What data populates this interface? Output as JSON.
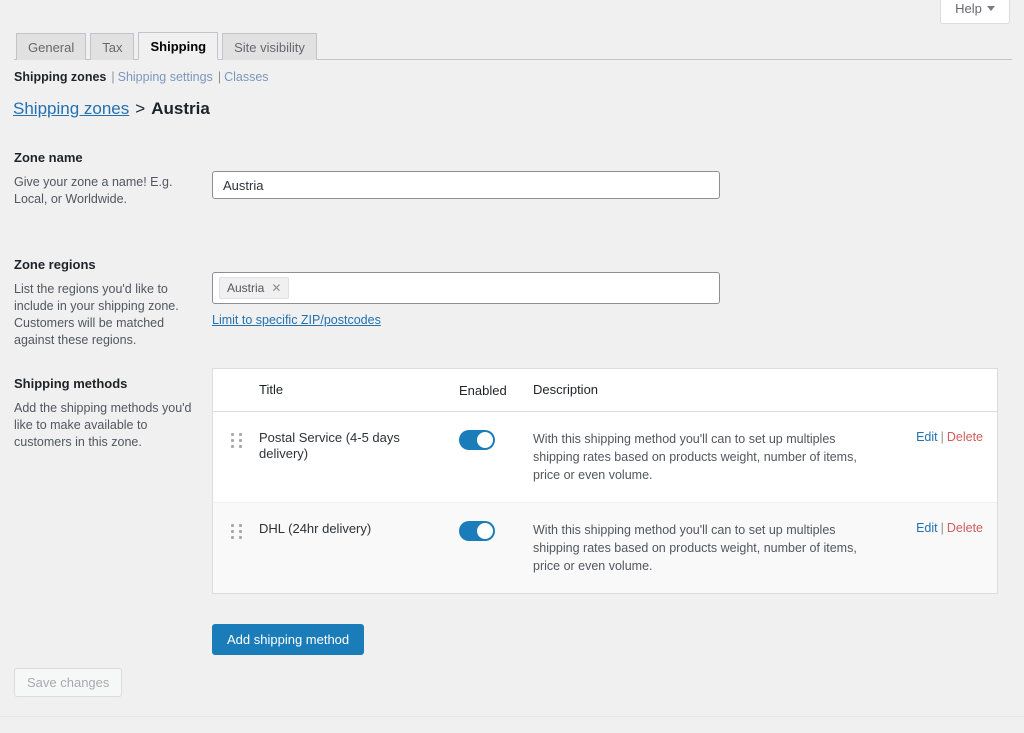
{
  "help": {
    "label": "Help",
    "icon": "chevron-down-icon"
  },
  "tabs": [
    {
      "label": "General",
      "active": false
    },
    {
      "label": "Tax",
      "active": false
    },
    {
      "label": "Shipping",
      "active": true
    },
    {
      "label": "Site visibility",
      "active": false
    }
  ],
  "subnav": {
    "current": "Shipping zones",
    "sep1": "|",
    "link1": "Shipping settings",
    "sep2": "|",
    "link2": "Classes"
  },
  "breadcrumb": {
    "parent": "Shipping zones",
    "separator": ">",
    "current": "Austria"
  },
  "zone_name": {
    "label": "Zone name",
    "description": "Give your zone a name! E.g. Local, or Worldwide.",
    "value": "Austria",
    "placeholder": "Zone name"
  },
  "zone_regions": {
    "label": "Zone regions",
    "description": "List the regions you'd like to include in your shipping zone. Customers will be matched against these regions.",
    "chips": [
      {
        "label": "Austria",
        "remove_icon": "close-icon"
      }
    ],
    "zip_link": "Limit to specific ZIP/postcodes"
  },
  "shipping_methods": {
    "label": "Shipping methods",
    "description": "Add the shipping methods you'd like to make available to customers in this zone.",
    "columns": {
      "handle": "",
      "title": "Title",
      "enabled": "Enabled",
      "description": "Description",
      "actions": ""
    },
    "rows": [
      {
        "handle_icon": "drag-handle-icon",
        "title": "Postal Service (4-5 days delivery)",
        "enabled": true,
        "description": "With this shipping method you'll can to set up multiples shipping rates based on products weight, number of items, price or even volume.",
        "edit": "Edit",
        "separator": "|",
        "delete": "Delete"
      },
      {
        "handle_icon": "drag-handle-icon",
        "title": "DHL (24hr delivery)",
        "enabled": true,
        "description": "With this shipping method you'll can to set up multiples shipping rates based on products weight, number of items, price or even volume.",
        "edit": "Edit",
        "separator": "|",
        "delete": "Delete"
      }
    ]
  },
  "buttons": {
    "add_shipping_method": "Add shipping method",
    "save_changes": "Save changes"
  },
  "colors": {
    "accent": "#1a7cb8",
    "link": "#2271b1",
    "delete": "#d05c5c",
    "page_bg": "#f0f0f1",
    "toggle_on": "#1a7cb8"
  }
}
